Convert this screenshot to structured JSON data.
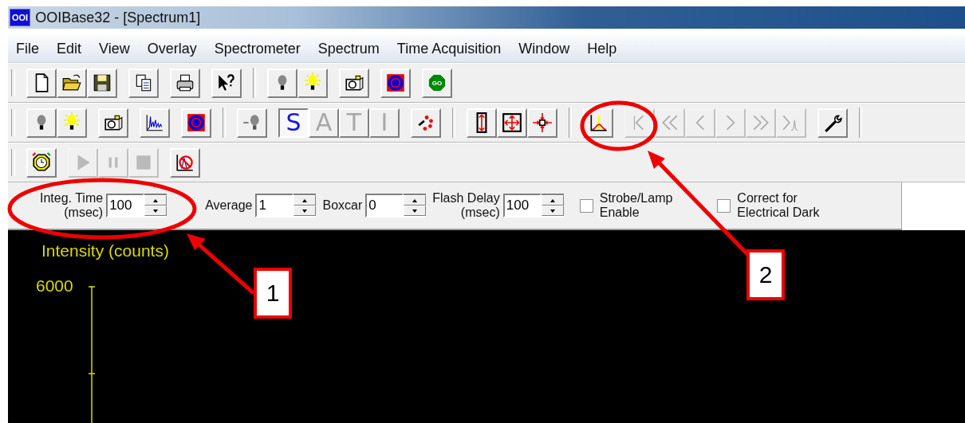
{
  "window": {
    "app_badge": "OOI",
    "title": "OOIBase32 - [Spectrum1]"
  },
  "menu": [
    {
      "label": "File"
    },
    {
      "label": "Edit"
    },
    {
      "label": "View"
    },
    {
      "label": "Overlay"
    },
    {
      "label": "Spectrometer"
    },
    {
      "label": "Spectrum"
    },
    {
      "label": "Time Acquisition"
    },
    {
      "label": "Window"
    },
    {
      "label": "Help"
    }
  ],
  "toolbars": [
    {
      "groups": [
        [
          {
            "kind": "new",
            "disabled": false
          },
          {
            "kind": "open",
            "disabled": false
          },
          {
            "kind": "save",
            "disabled": false
          }
        ],
        [
          {
            "kind": "copy",
            "disabled": false
          }
        ],
        [
          {
            "kind": "print",
            "disabled": false
          }
        ],
        [
          {
            "kind": "help",
            "disabled": false
          }
        ],
        [
          {
            "kind": "separator"
          }
        ],
        [
          {
            "kind": "bulb",
            "disabled": false
          },
          {
            "kind": "lamp",
            "disabled": false
          }
        ],
        [
          {
            "kind": "camera",
            "disabled": false
          }
        ],
        [
          {
            "kind": "target",
            "disabled": false
          }
        ],
        [
          {
            "kind": "go",
            "label": "GO",
            "disabled": false
          }
        ]
      ]
    },
    {
      "groups": [
        [
          {
            "kind": "bulb",
            "disabled": false
          },
          {
            "kind": "lamp",
            "disabled": false
          }
        ],
        [
          {
            "kind": "camera",
            "disabled": false
          }
        ],
        [
          {
            "kind": "spectrum",
            "disabled": false
          }
        ],
        [
          {
            "kind": "target",
            "disabled": false
          }
        ],
        [
          {
            "kind": "separator"
          }
        ],
        [
          {
            "kind": "dim-bulb",
            "disabled": false
          }
        ],
        [
          {
            "kind": "mode",
            "label": "S",
            "selected": true
          },
          {
            "kind": "mode",
            "label": "A",
            "selected": false
          },
          {
            "kind": "mode",
            "label": "T",
            "selected": false
          },
          {
            "kind": "mode",
            "label": "I",
            "selected": false
          }
        ],
        [
          {
            "kind": "dots",
            "disabled": false
          }
        ],
        [
          {
            "kind": "separator"
          }
        ],
        [
          {
            "kind": "fit-vertical",
            "disabled": false
          },
          {
            "kind": "fit-both",
            "disabled": false
          },
          {
            "kind": "shrink",
            "disabled": false
          }
        ],
        [
          {
            "kind": "separator"
          }
        ],
        [
          {
            "kind": "peak",
            "disabled": false
          }
        ],
        [
          {
            "kind": "first",
            "disabled": true
          },
          {
            "kind": "back-fast",
            "disabled": true
          },
          {
            "kind": "back",
            "disabled": true
          },
          {
            "kind": "forward",
            "disabled": true
          },
          {
            "kind": "forward-fast",
            "disabled": true
          },
          {
            "kind": "to-peak",
            "disabled": true
          }
        ],
        [
          {
            "kind": "wrench",
            "disabled": false
          }
        ],
        [
          {
            "kind": "separator"
          }
        ]
      ]
    },
    {
      "groups": [
        [
          {
            "kind": "alarm",
            "disabled": false
          }
        ],
        [
          {
            "kind": "play",
            "disabled": true
          },
          {
            "kind": "pause",
            "disabled": true
          },
          {
            "kind": "stop",
            "disabled": true
          }
        ],
        [
          {
            "kind": "no-graph",
            "disabled": false
          }
        ]
      ]
    }
  ],
  "controls": [
    {
      "kind": "spin",
      "label": "Integ. Time\n(msec)",
      "value": "100"
    },
    {
      "kind": "spin",
      "label": "Average",
      "value": "1"
    },
    {
      "kind": "spin",
      "label": "Boxcar",
      "value": "0"
    },
    {
      "kind": "spin",
      "label": "Flash Delay\n(msec)",
      "value": "100"
    },
    {
      "kind": "check",
      "label": "Strobe/Lamp\nEnable",
      "checked": false
    },
    {
      "kind": "check",
      "label": "Correct for\nElectrical Dark",
      "checked": false
    }
  ],
  "plot": {
    "ylabel": "Intensity (counts)",
    "yticks": [
      "6000"
    ]
  },
  "annotations": [
    {
      "label": "1"
    },
    {
      "label": "2"
    }
  ]
}
